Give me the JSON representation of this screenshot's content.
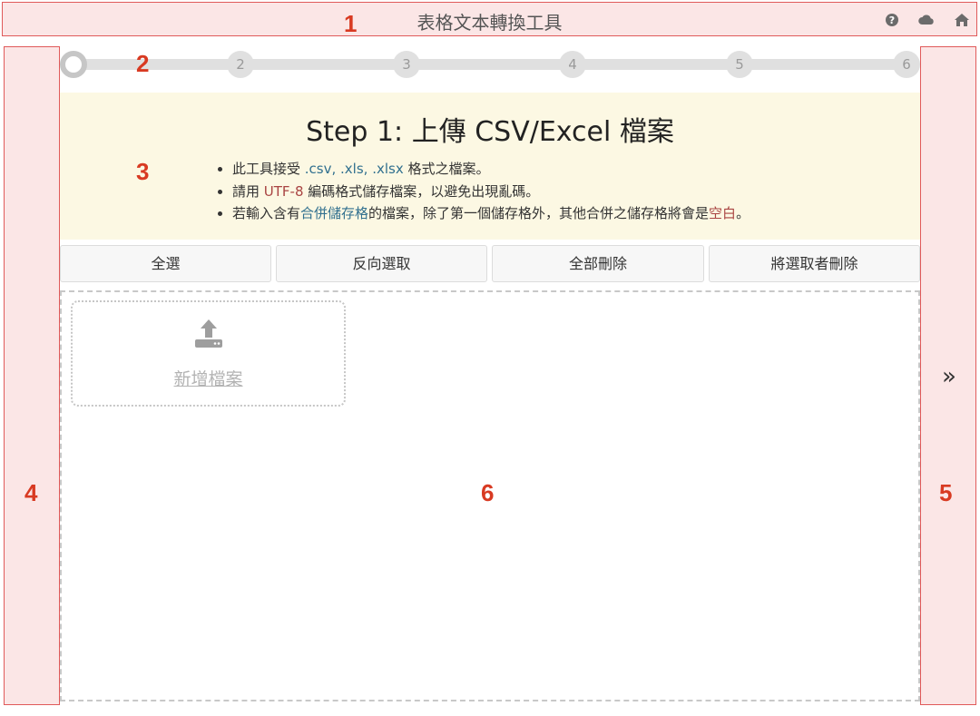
{
  "header": {
    "title": "表格文本轉換工具",
    "annotation": "1",
    "icons": [
      "help-icon",
      "cloud-icon",
      "home-icon"
    ]
  },
  "stepper": {
    "annotation": "2",
    "steps": [
      "",
      "2",
      "3",
      "4",
      "5",
      "6"
    ],
    "current_step": 1
  },
  "instructions": {
    "annotation": "3",
    "title": "Step 1: 上傳 CSV/Excel 檔案",
    "line1": {
      "a": "此工具接受 ",
      "b": ".csv, .xls, .xlsx",
      "c": " 格式之檔案。"
    },
    "line2": {
      "a": "請用 ",
      "b": "UTF-8",
      "c": " 編碼格式儲存檔案，以避免出現亂碼。"
    },
    "line3": {
      "a": "若輸入含有",
      "b": "合併儲存格",
      "c": "的檔案，除了第一個儲存格外，其他合併之儲存格將會是",
      "d": "空白",
      "e": "。"
    }
  },
  "actions": {
    "select_all": "全選",
    "invert_selection": "反向選取",
    "delete_all": "全部刪除",
    "delete_selected": "將選取者刪除"
  },
  "left_panel": {
    "annotation": "4"
  },
  "right_panel": {
    "annotation": "5",
    "next_symbol": "»"
  },
  "dropzone": {
    "annotation": "6",
    "add_file_label": "新增檔案",
    "icon": "upload-icon"
  },
  "colors": {
    "annotation_red": "#d83a22",
    "annotation_fill": "#fbe6e6",
    "instruction_bg": "#fcf8e3",
    "highlight_blue": "#31708f",
    "highlight_red": "#a94442"
  }
}
